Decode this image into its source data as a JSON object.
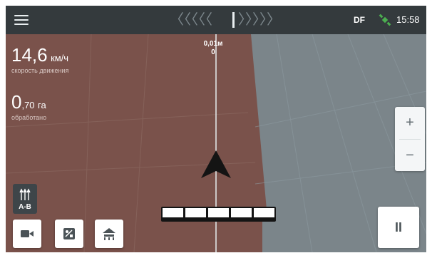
{
  "topbar": {
    "menu_icon": "hamburger-menu-icon",
    "guidance_left_chevrons": "〈〈〈〈〈",
    "guidance_right_chevrons": "〉〉〉〉〉",
    "correction_label": "DF",
    "gps_icon": "satellite-icon",
    "time": "15:58"
  },
  "readouts": {
    "speed_value": "14,6",
    "speed_unit": "км/ч",
    "speed_caption": "скорость движения",
    "area_value": "0",
    "area_decimals": ",70",
    "area_unit": "га",
    "area_caption": "обработано"
  },
  "guidance": {
    "offset": "0,01м",
    "line_number": "0"
  },
  "controls": {
    "ab_line_label": "A-B",
    "ab_line_icon": "ab-line-icon",
    "camera_icon": "camera-icon",
    "map_icon": "map-icon",
    "implement_icon": "implement-icon",
    "zoom_in_label": "+",
    "zoom_out_label": "−",
    "pause_icon": "pause-icon",
    "pause_label": "II"
  },
  "colors": {
    "topbar": "#343a3d",
    "worked_area": "#7a524b",
    "unworked_area": "#7b858a",
    "vehicle": "#141414",
    "implement_sections": "#ffffff"
  }
}
